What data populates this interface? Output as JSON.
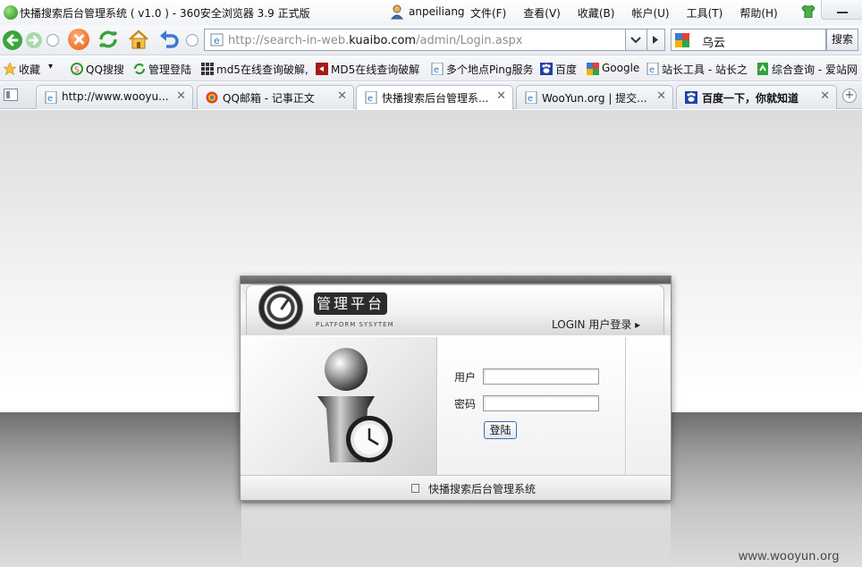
{
  "window": {
    "title": "快播搜索后台管理系统 ( v1.0 ) - 360安全浏览器 3.9 正式版",
    "user": "anpeiliang",
    "menu": [
      "文件(F)",
      "查看(V)",
      "收藏(B)",
      "帐户(U)",
      "工具(T)",
      "帮助(H)"
    ]
  },
  "address_bar": {
    "url_prefix": "http://search-in-web.",
    "url_domain": "kuaibo.com",
    "url_path": "/admin/Login.aspx"
  },
  "search": {
    "value": "乌云",
    "button": "搜索"
  },
  "bookmarks": [
    {
      "label": "收藏",
      "icon": "star-icon"
    },
    {
      "label": "QQ搜搜",
      "icon": "soso-icon"
    },
    {
      "label": "管理登陆",
      "icon": "refresh-green-icon"
    },
    {
      "label": "md5在线查询破解,",
      "icon": "grid-icon"
    },
    {
      "label": "MD5在线查询破解",
      "icon": "red-square-icon"
    },
    {
      "label": "多个地点Ping服务",
      "icon": "ie-page-icon"
    },
    {
      "label": "百度",
      "icon": "paw-icon"
    },
    {
      "label": "Google",
      "icon": "google-icon"
    },
    {
      "label": "站长工具 - 站长之",
      "icon": "ie-page-icon"
    },
    {
      "label": "综合查询 - 爱站网",
      "icon": "green-page-icon"
    }
  ],
  "tabs": [
    {
      "label": "http://www.wooyu...",
      "icon": "ie-page-icon",
      "active": false
    },
    {
      "label": "QQ邮箱 - 记事正文",
      "icon": "qq-mail-icon",
      "active": false
    },
    {
      "label": "快播搜索后台管理系...",
      "icon": "ie-page-icon",
      "active": true
    },
    {
      "label": "WooYun.org | 提交...",
      "icon": "ie-page-icon",
      "active": false
    },
    {
      "label": "百度一下，你就知道",
      "icon": "paw-icon",
      "active": false
    }
  ],
  "login": {
    "title": "管理平台",
    "subtitle": "PLATFORM SYSYTEM",
    "login_label": "LOGIN 用户登录 ▸",
    "username_label": "用户",
    "password_label": "密码",
    "username_value": "",
    "password_value": "",
    "submit": "登陆",
    "footer": "快播搜索后台管理系统"
  },
  "watermark": "www.wooyun.org",
  "colors": {
    "accent_blue": "#2f6fb5",
    "nav_green": "#3aa53a",
    "stop_orange": "#e65a0a"
  }
}
